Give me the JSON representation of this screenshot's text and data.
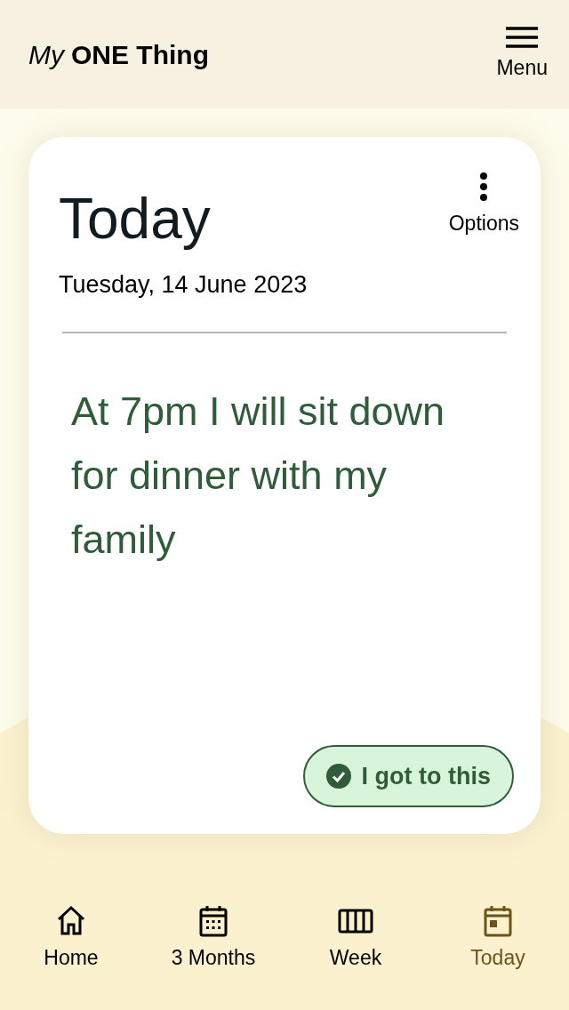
{
  "header": {
    "logo_prefix": "My",
    "logo_name": "ONE Thing",
    "menu_label": "Menu"
  },
  "card": {
    "title": "Today",
    "date": "Tuesday, 14 June 2023",
    "options_label": "Options",
    "commitment": "At 7pm I will sit down for dinner with my family",
    "done_button": "I got to this"
  },
  "nav": [
    {
      "kind": "home",
      "label": "Home",
      "selected": false
    },
    {
      "kind": "months",
      "label": "3 Months",
      "selected": false
    },
    {
      "kind": "week",
      "label": "Week",
      "selected": false
    },
    {
      "kind": "today",
      "label": "Today",
      "selected": true
    }
  ]
}
